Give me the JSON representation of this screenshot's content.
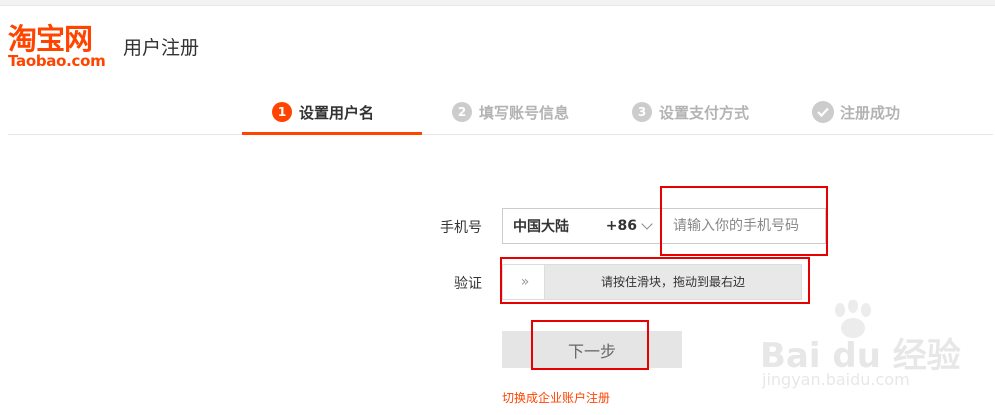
{
  "header": {
    "logo_cn": "淘宝网",
    "logo_en": "Taobao.com",
    "title": "用户注册"
  },
  "steps": [
    {
      "num": "1",
      "label": "设置用户名",
      "active": true
    },
    {
      "num": "2",
      "label": "填写账号信息",
      "active": false
    },
    {
      "num": "3",
      "label": "设置支付方式",
      "active": false
    },
    {
      "num": "",
      "label": "注册成功",
      "active": false
    }
  ],
  "form": {
    "phone_label": "手机号",
    "country_name": "中国大陆",
    "country_code": "+86",
    "phone_placeholder": "请输入你的手机号码",
    "verify_label": "验证",
    "slider_handle": "»",
    "slider_text": "请按住滑块，拖动到最右边",
    "next_label": "下一步",
    "enterprise_link": "切换成企业账户注册"
  },
  "watermark": {
    "brand": "Bai du 经验",
    "url": "jingyan.baidu.com"
  },
  "colors": {
    "brand": "#ff4400",
    "highlight_box": "#e60000",
    "inactive": "#cccccc"
  }
}
